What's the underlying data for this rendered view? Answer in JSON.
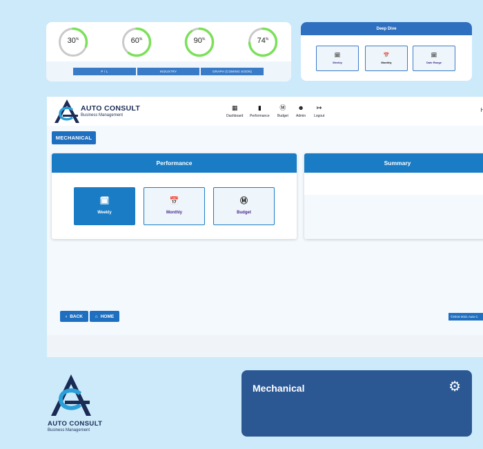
{
  "gauges": [
    {
      "value": "30",
      "unit": "%",
      "fraction": 0.3
    },
    {
      "value": "60",
      "unit": "%",
      "fraction": 0.6
    },
    {
      "value": "90",
      "unit": "%",
      "fraction": 0.9
    },
    {
      "value": "74",
      "unit": "%",
      "fraction": 0.74
    }
  ],
  "gauge_buttons": [
    "P / L",
    "INDUSTRY",
    "GRAPH (COMING SOON)"
  ],
  "deep_dive": {
    "title": "Deep Dive",
    "buttons": [
      {
        "label": "Weekly",
        "icon": "calendar-week-icon"
      },
      {
        "label": "Monthly",
        "icon": "calendar-month-icon"
      },
      {
        "label": "Date Range",
        "icon": "date-range-icon"
      }
    ]
  },
  "brand": {
    "name": "AUTO CONSULT",
    "tagline": "Business Management"
  },
  "nav": [
    {
      "label": "Dashboard",
      "icon": "dashboard-icon"
    },
    {
      "label": "Performance",
      "icon": "bar-chart-icon"
    },
    {
      "label": "Budget",
      "icon": "dollar-icon"
    },
    {
      "label": "Admin",
      "icon": "admin-icon"
    },
    {
      "label": "Logout",
      "icon": "logout-icon"
    }
  ],
  "greeting": "Hi",
  "category_button": "MECHANICAL",
  "performance_panel": {
    "title": "Performance",
    "buttons": [
      {
        "label": "Weekly",
        "icon": "calendar-icon",
        "active": true
      },
      {
        "label": "Monthly",
        "icon": "calendar-month-icon",
        "active": false
      },
      {
        "label": "Budget",
        "icon": "dollar-icon",
        "active": false
      }
    ]
  },
  "summary_panel": {
    "title": "Summary"
  },
  "footer": {
    "back": "BACK",
    "home": "HOME",
    "copyright": "©2016-2021 Auto C"
  },
  "mechanical_card": {
    "title": "Mechanical",
    "icon": "gear-icon"
  },
  "colors": {
    "background": "#cdeafa",
    "primary": "#1a7cc4",
    "header_blue": "#2f6fbf",
    "card_dark": "#2b5793",
    "gauge_green": "#7be05a",
    "gauge_track": "#c9c9c9"
  }
}
